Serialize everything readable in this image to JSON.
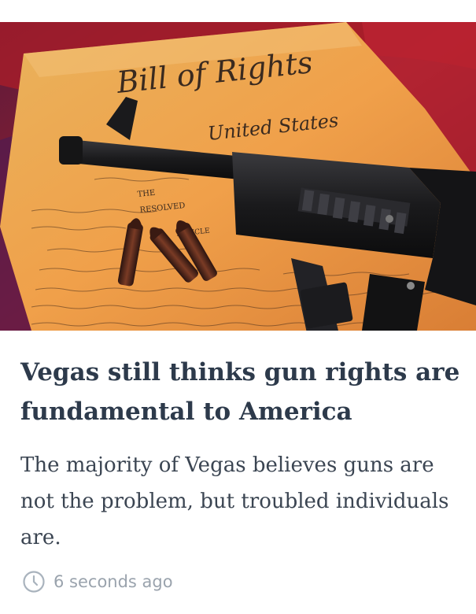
{
  "article": {
    "image": {
      "icon": "photo-bill-of-rights-rifle",
      "document_title": "Bill of Rights",
      "document_subtitle": "United States",
      "document_words": [
        "THE",
        "RESOLVED",
        "ARTICLE"
      ]
    },
    "headline": "Vegas still thinks gun rights are fundamental to America",
    "summary": "The majority of Vegas believes guns are not the problem, but troubled individuals are.",
    "timestamp": "6 seconds ago",
    "clock_icon": "clock-icon",
    "colors": {
      "headline": "#2d3a4b",
      "summary": "#3b4552",
      "timestamp": "#9aa3ad"
    }
  }
}
